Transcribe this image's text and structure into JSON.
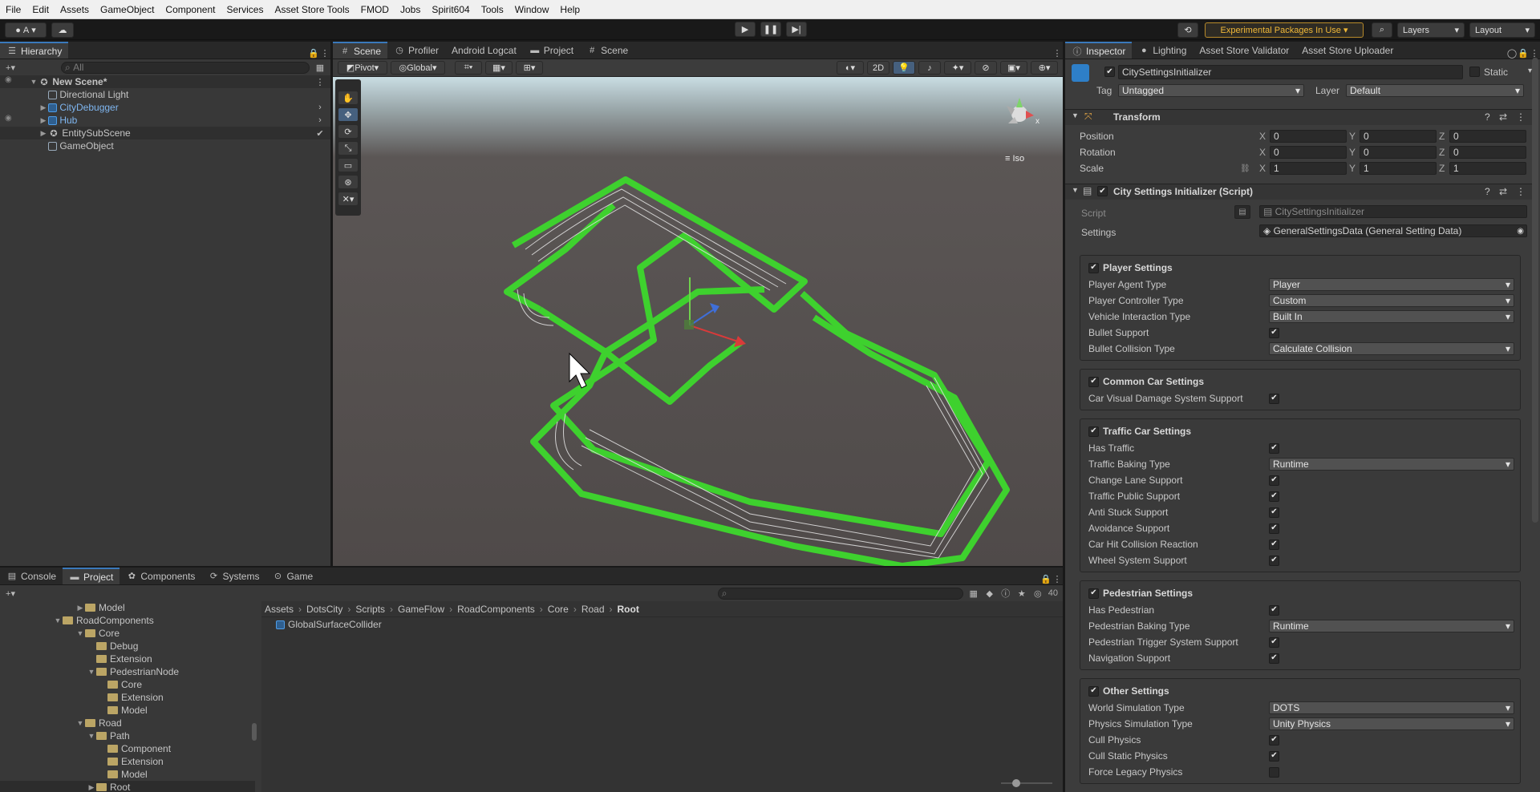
{
  "menu": [
    "File",
    "Edit",
    "Assets",
    "GameObject",
    "Component",
    "Services",
    "Asset Store Tools",
    "FMOD",
    "Jobs",
    "Spirit604",
    "Tools",
    "Window",
    "Help"
  ],
  "toolbar": {
    "account": "A",
    "experimental": "Experimental Packages In Use",
    "layers": "Layers",
    "layout": "Layout"
  },
  "hierarchy": {
    "tab": "Hierarchy",
    "search_placeholder": "All",
    "scene": "New Scene*",
    "items": [
      "Directional Light",
      "CityDebugger",
      "Hub",
      "EntitySubScene",
      "GameObject"
    ]
  },
  "scene_tabs": [
    "Scene",
    "Profiler",
    "Android Logcat",
    "Project",
    "Scene"
  ],
  "scene_toolbar": {
    "pivot": "Pivot",
    "global": "Global",
    "mode2d": "2D",
    "iso": "Iso",
    "gizmo_x": "x"
  },
  "inspector_tabs": [
    "Inspector",
    "Lighting",
    "Asset Store Validator",
    "Asset Store Uploader"
  ],
  "inspector": {
    "object_name": "CitySettingsInitializer",
    "static": "Static",
    "tag_label": "Tag",
    "tag": "Untagged",
    "layer_label": "Layer",
    "layer": "Default",
    "transform": {
      "title": "Transform",
      "rows": [
        {
          "label": "Position",
          "x": "0",
          "y": "0",
          "z": "0"
        },
        {
          "label": "Rotation",
          "x": "0",
          "y": "0",
          "z": "0"
        },
        {
          "label": "Scale",
          "x": "1",
          "y": "1",
          "z": "1"
        }
      ]
    },
    "script_component": {
      "title": "City Settings Initializer (Script)",
      "script_label": "Script",
      "script": "CitySettingsInitializer",
      "settings_label": "Settings",
      "settings": "GeneralSettingsData (General Setting Data)"
    },
    "sections": [
      {
        "title": "Player Settings",
        "rows": [
          {
            "label": "Player Agent Type",
            "value": "Player"
          },
          {
            "label": "Player Controller Type",
            "value": "Custom"
          },
          {
            "label": "Vehicle Interaction Type",
            "value": "Built In"
          },
          {
            "label": "Bullet Support",
            "check": true
          },
          {
            "label": "Bullet Collision Type",
            "value": "Calculate Collision"
          }
        ]
      },
      {
        "title": "Common Car Settings",
        "rows": [
          {
            "label": "Car Visual Damage System Support",
            "check": true
          }
        ]
      },
      {
        "title": "Traffic Car Settings",
        "rows": [
          {
            "label": "Has Traffic",
            "check": true
          },
          {
            "label": "Traffic Baking Type",
            "value": "Runtime"
          },
          {
            "label": "Change Lane Support",
            "check": true
          },
          {
            "label": "Traffic Public Support",
            "check": true
          },
          {
            "label": "Anti Stuck Support",
            "check": true
          },
          {
            "label": "Avoidance Support",
            "check": true
          },
          {
            "label": "Car Hit Collision Reaction",
            "check": true
          },
          {
            "label": "Wheel System Support",
            "check": true
          }
        ]
      },
      {
        "title": "Pedestrian Settings",
        "rows": [
          {
            "label": "Has Pedestrian",
            "check": true
          },
          {
            "label": "Pedestrian Baking Type",
            "value": "Runtime"
          },
          {
            "label": "Pedestrian Trigger System Support",
            "check": true
          },
          {
            "label": "Navigation Support",
            "check": true
          }
        ]
      },
      {
        "title": "Other Settings",
        "rows": [
          {
            "label": "World Simulation Type",
            "value": "DOTS"
          },
          {
            "label": "Physics Simulation Type",
            "value": "Unity Physics"
          },
          {
            "label": "Cull Physics",
            "check": true
          },
          {
            "label": "Cull Static Physics",
            "check": true
          },
          {
            "label": "Force Legacy Physics",
            "check": false
          }
        ]
      }
    ]
  },
  "bottom_tabs": [
    "Console",
    "Project",
    "Components",
    "Systems",
    "Game"
  ],
  "project": {
    "tree": [
      "Model",
      "RoadComponents",
      "Core",
      "Debug",
      "Extension",
      "PedestrianNode",
      "Core",
      "Extension",
      "Model",
      "Road",
      "Path",
      "Component",
      "Extension",
      "Model",
      "Root"
    ],
    "breadcrumb": [
      "Assets",
      "DotsCity",
      "Scripts",
      "GameFlow",
      "RoadComponents",
      "Core",
      "Road",
      "Root"
    ],
    "asset": "GlobalSurfaceCollider",
    "count": "40"
  }
}
